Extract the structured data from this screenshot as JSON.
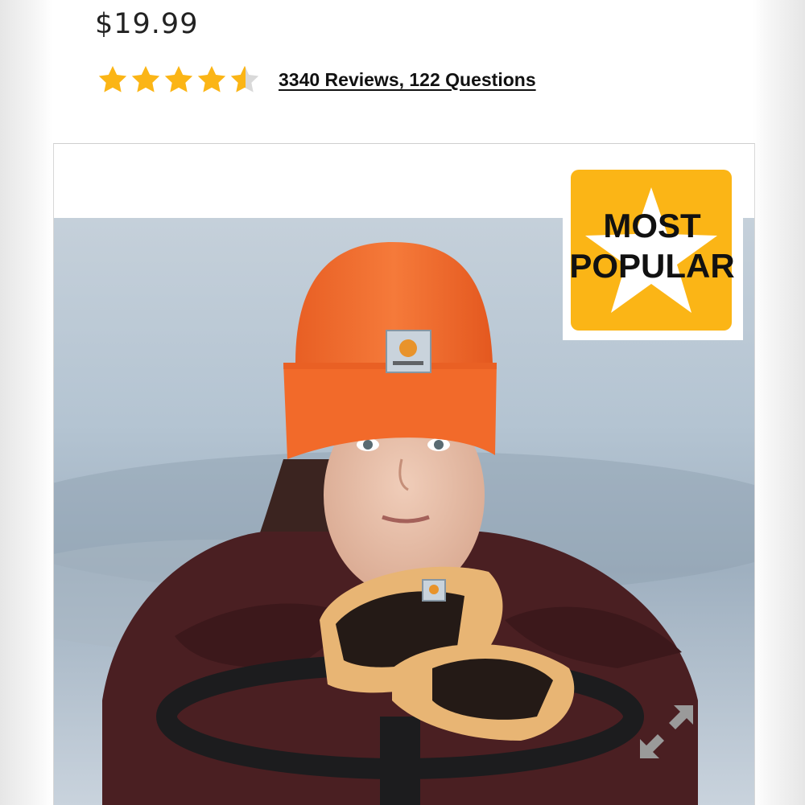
{
  "product": {
    "price": "$19.99",
    "rating": 4.5,
    "rating_max": 5,
    "reviews_text": "3340 Reviews, 122 Questions"
  },
  "badge": {
    "line1": "MOST",
    "line2": "POPULAR"
  },
  "colors": {
    "star": "#fbb516",
    "star_empty": "#d9d9d9",
    "badge_bg": "#fbb516",
    "beanie": "#f26a2a"
  },
  "icons": {
    "expand": "expand-arrows-icon",
    "star": "star-icon"
  }
}
